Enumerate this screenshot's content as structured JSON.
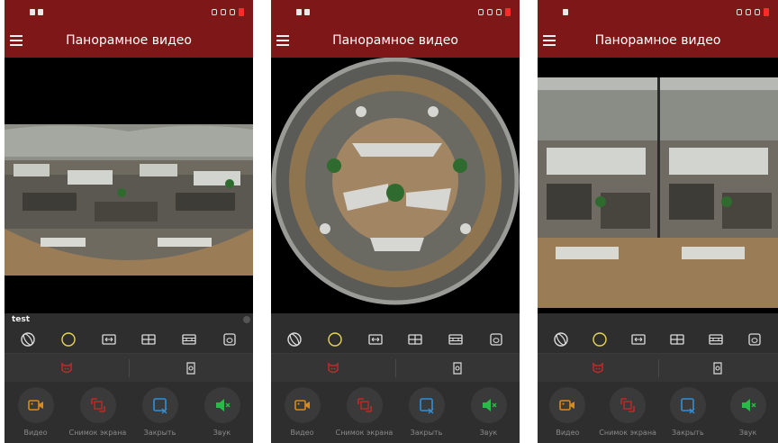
{
  "app": {
    "title": "Панорамное видео",
    "camera_name": "test"
  },
  "colors": {
    "app_bar": "#7e1717",
    "panel": "#2e2e2e",
    "mode_active": "#e8d45a",
    "mode_icon": "#dcdcdc",
    "record_icon": "#d98a1e",
    "snapshot_icon": "#c02a2a",
    "close_icon": "#2f8fd8",
    "sound_icon": "#2fb84a"
  },
  "mode_icons": [
    "fisheye-icon",
    "circle-mode-icon",
    "panorama-180-icon",
    "quad-split-icon",
    "dual-split-icon",
    "cylinder-icon"
  ],
  "control_icons": [
    "ptz-face-icon",
    "gyroscope-icon"
  ],
  "actions": [
    {
      "icon": "video-record-icon",
      "label": "Видео"
    },
    {
      "icon": "snapshot-icon",
      "label": "Снимок экрана"
    },
    {
      "icon": "close-view-icon",
      "label": "Закрыть"
    },
    {
      "icon": "speaker-mute-icon",
      "label": "Звук"
    }
  ],
  "screens": [
    {
      "active_mode": 1,
      "show_camera_name": true
    },
    {
      "active_mode": 1,
      "show_camera_name": false
    },
    {
      "active_mode": 1,
      "show_camera_name": false
    }
  ]
}
